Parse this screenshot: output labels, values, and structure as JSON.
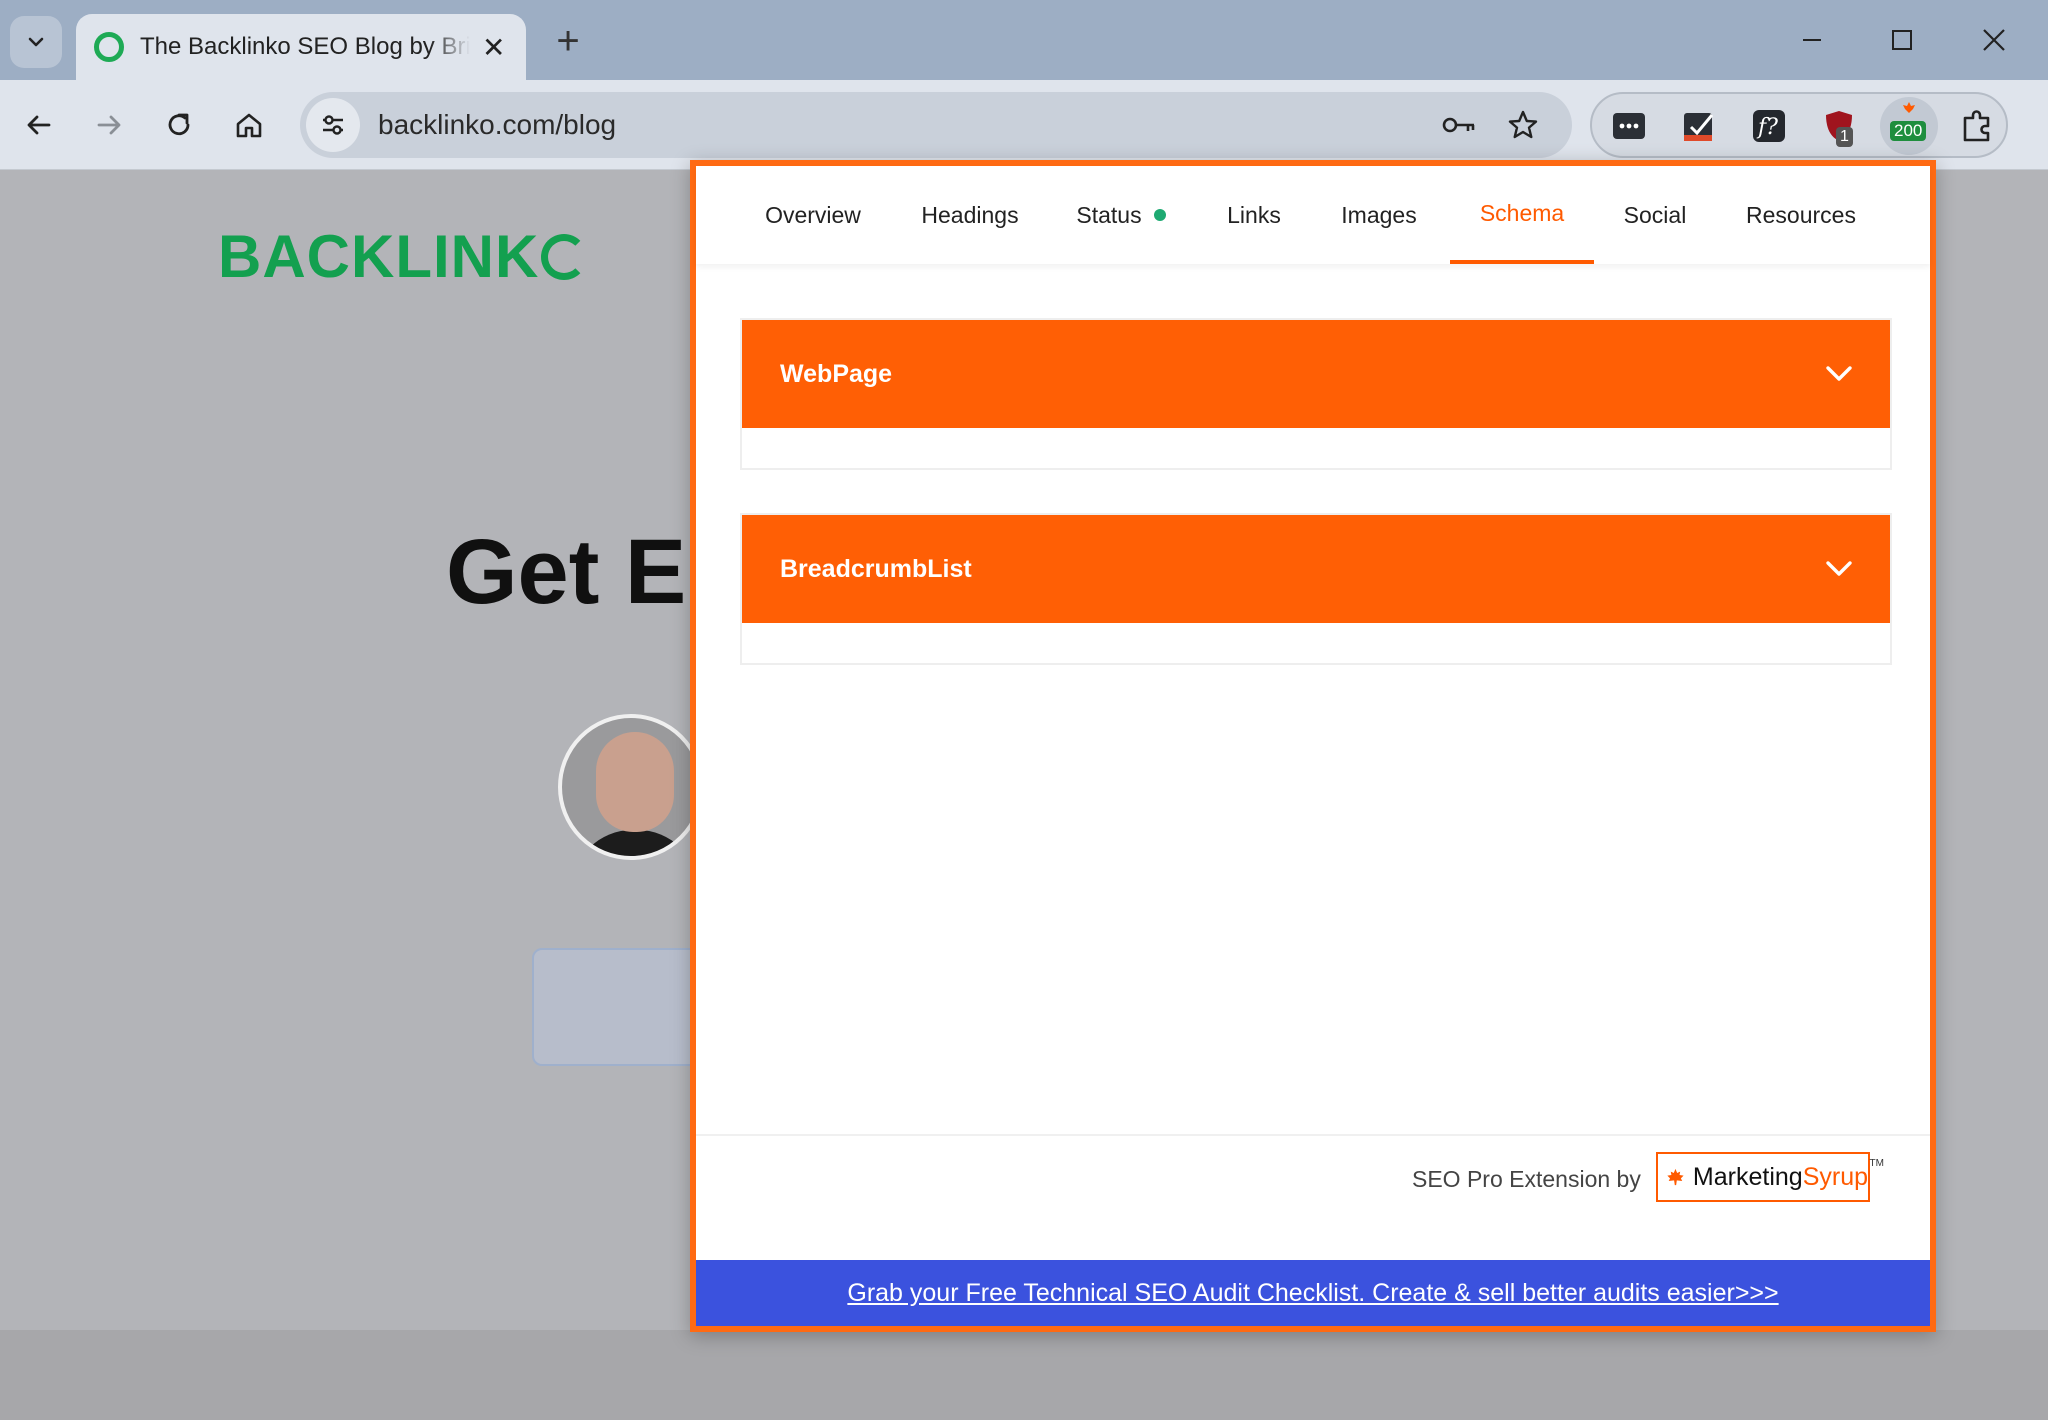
{
  "browser": {
    "tab_title": "The Backlinko SEO Blog by Brian Dean",
    "tab_close": "✕",
    "new_tab": "+",
    "url": "backlinko.com/blog",
    "extension_badges": {
      "ublock": "1",
      "seo_status": "200"
    }
  },
  "page": {
    "logo_text": "BACKLINK",
    "hero_title": "Get E"
  },
  "popup": {
    "tabs": [
      {
        "label": "Overview"
      },
      {
        "label": "Headings"
      },
      {
        "label": "Status"
      },
      {
        "label": "Links"
      },
      {
        "label": "Images"
      },
      {
        "label": "Schema"
      },
      {
        "label": "Social"
      },
      {
        "label": "Resources"
      }
    ],
    "active_tab": "Schema",
    "schemas": [
      {
        "title": "WebPage"
      },
      {
        "title": "BreadcrumbList"
      }
    ],
    "footer_credit": "SEO Pro Extension by",
    "brand_a": "Marketing",
    "brand_b": "Syrup",
    "brand_tm": "TM",
    "promo_link": "Grab your Free Technical SEO Audit Checklist. Create & sell better audits easier>>>"
  },
  "colors": {
    "accent": "#ff5f05",
    "promo_bg": "#3b52de",
    "brand_green": "#13a04f",
    "status_dot": "#1eaa72"
  }
}
